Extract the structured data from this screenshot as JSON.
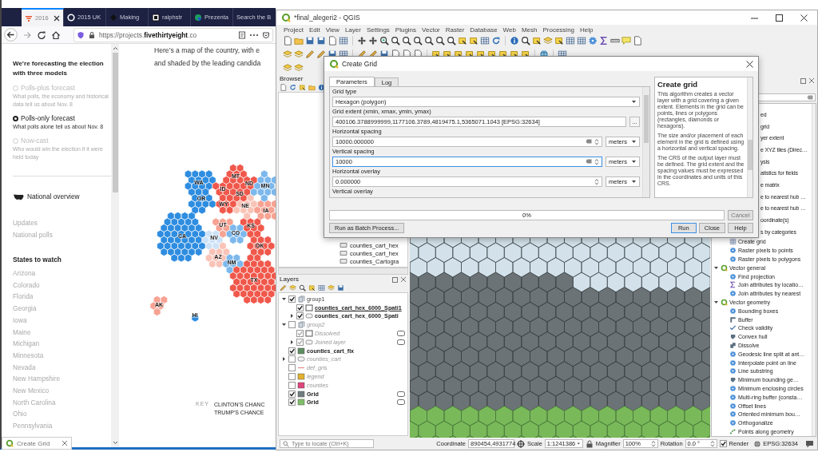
{
  "browser": {
    "tabs": [
      {
        "label": "2016",
        "selected": true
      },
      {
        "label": "2015 UK",
        "selected": false
      },
      {
        "label": "Making",
        "selected": false
      },
      {
        "label": "ralphstr",
        "selected": false
      },
      {
        "label": "Prezenta",
        "selected": false
      },
      {
        "label": "Search the B",
        "selected": false
      }
    ],
    "url": "https://projects.**fivethirtyeight**.co",
    "sidebar": {
      "heading": "We’re forecasting the election with three models",
      "models": [
        {
          "title": "Polls-plus forecast",
          "description": "What polls, the economy and historical data tell us about Nov. 8",
          "selected": false
        },
        {
          "title": "Polls-only forecast",
          "description": "What polls alone tell us about Nov. 8",
          "selected": true
        },
        {
          "title": "Now-cast",
          "description": "Who would win the election if it were held today",
          "selected": false
        }
      ],
      "nav": [
        {
          "label": "National overview",
          "kind": "overview"
        },
        {
          "label": "Updates",
          "kind": "link"
        },
        {
          "label": "National polls",
          "kind": "link"
        }
      ],
      "states_heading": "States to watch",
      "states": [
        "Arizona",
        "Colorado",
        "Florida",
        "Georgia",
        "Iowa",
        "Maine",
        "Michigan",
        "Minnesota",
        "Nevada",
        "New Hampshire",
        "New Mexico",
        "North Carolina",
        "Ohio",
        "Pennsylvania"
      ]
    },
    "article": {
      "text": "Here’s a map of the country, with e\nand shaded by the leading candida",
      "map_states": [
        {
          "label": "WA",
          "color": "#2e8de0"
        },
        {
          "label": "OR",
          "color": "#2e8de0"
        },
        {
          "label": "CA",
          "color": "#2e8de0"
        },
        {
          "label": "ID",
          "color": "#f0584b"
        },
        {
          "label": "MT",
          "color": "#f0584b"
        },
        {
          "label": "ND",
          "color": "#f0584b"
        },
        {
          "label": "SD",
          "color": "#f0584b"
        },
        {
          "label": "WY",
          "color": "#f0584b"
        },
        {
          "label": "NE",
          "color": "#fac3b7"
        },
        {
          "label": "IA",
          "color": "#f7a292"
        },
        {
          "label": "MN",
          "color": "#7cb8ec"
        },
        {
          "label": "UT",
          "color": "#f7a292"
        },
        {
          "label": "NV",
          "color": "#cde2f6"
        },
        {
          "label": "CO",
          "color": "#7cb8ec"
        },
        {
          "label": "KS",
          "color": "#f0584b"
        },
        {
          "label": "AZ",
          "color": "#fac3b7"
        },
        {
          "label": "NM",
          "color": "#7cb8ec"
        },
        {
          "label": "OK",
          "color": "#f0584b"
        },
        {
          "label": "TX",
          "color": "#f0584b"
        },
        {
          "label": "AK",
          "color": "#f7a292"
        },
        {
          "label": "HI",
          "color": "#2e8de0"
        }
      ],
      "key_label": "KEY",
      "key_items": [
        "CLINTON'S CHANC",
        "TRUMP'S CHANCE"
      ]
    },
    "taskbar_preview": {
      "title": "Create Grid"
    }
  },
  "qgis": {
    "title": "*final_alegeri2 - QGIS",
    "menu": [
      "Project",
      "Edit",
      "View",
      "Layer",
      "Settings",
      "Plugins",
      "Vector",
      "Raster",
      "Database",
      "Web",
      "Mesh",
      "Processing",
      "Help"
    ],
    "browser_panel": {
      "title": "Browser",
      "items": [
        "counties_cart_hex",
        "counties_cart_hex",
        "counties_Cartogra"
      ]
    },
    "layers_panel": {
      "title": "Layers",
      "layers": [
        {
          "name": "group1",
          "kind": "group",
          "checked": true,
          "expanded": true,
          "selected": false,
          "children": [
            {
              "name": "counties_cart_hex_6000_Spati1",
              "kind": "outline",
              "checked": true,
              "selected": true
            },
            {
              "name": "counties_cart_hex_6000_Spati",
              "kind": "categorized",
              "checked": true,
              "expanded": false,
              "selected": false
            }
          ]
        },
        {
          "name": "group2",
          "kind": "group",
          "checked": false,
          "expanded": true,
          "selected": false,
          "children": [
            {
              "name": "Dissolved",
              "kind": "outline",
              "checked": true,
              "indicator": true,
              "selected": false
            },
            {
              "name": "Joined layer",
              "kind": "categorized",
              "checked": true,
              "expanded": false,
              "indicator": true,
              "selected": false
            }
          ]
        },
        {
          "name": "counties_cart_fix",
          "kind": "fill",
          "color": "#5e8f62",
          "checked": true,
          "selected": false
        },
        {
          "name": "counties_cart",
          "kind": "categorized",
          "checked": false,
          "expanded": false,
          "selected": false
        },
        {
          "name": "def_gris",
          "kind": "line",
          "color": "#e58a8a",
          "checked": false,
          "selected": false
        },
        {
          "name": "legend",
          "kind": "fill",
          "color": "#e2b12f",
          "checked": false,
          "selected": false
        },
        {
          "name": "counties",
          "kind": "fill",
          "color": "#e0457b",
          "checked": false,
          "selected": false
        },
        {
          "name": "Grid",
          "kind": "fill",
          "color": "#6f7c80",
          "checked": true,
          "indicator": true,
          "selected": false
        },
        {
          "name": "Grid",
          "kind": "fill",
          "color": "#7fbf6a",
          "checked": true,
          "indicator": true,
          "selected": false
        }
      ]
    },
    "toolbox": {
      "items": [
        {
          "label": "ed",
          "kind": "covered"
        },
        {
          "label": "grid",
          "kind": "covered"
        },
        {
          "label": "yer extent",
          "kind": "covered"
        },
        {
          "label": "e XYZ tiles (Direc…",
          "kind": "covered"
        },
        {
          "label": "ysis",
          "kind": "covered"
        },
        {
          "label": "atistics for fields",
          "kind": "covered"
        },
        {
          "label": "e matrix",
          "kind": "covered"
        },
        {
          "label": "e to nearest hub …",
          "kind": "covered"
        },
        {
          "label": "e to nearest hub …",
          "kind": "covered"
        },
        {
          "label": "oordinate(s)",
          "kind": "covered"
        },
        {
          "label": "s by categories",
          "kind": "covered"
        },
        {
          "label": "Create grid",
          "kind": "grid"
        },
        {
          "label": "Raster pixels to points",
          "kind": "gear"
        },
        {
          "label": "Raster pixels to polygons",
          "kind": "gear"
        },
        {
          "label": "Vector general",
          "kind": "group",
          "expanded": true,
          "children": [
            {
              "label": "Find projection",
              "kind": "gear"
            },
            {
              "label": "Join attributes by locatio…",
              "kind": "sigma"
            },
            {
              "label": "Join attributes by nearest",
              "kind": "gear"
            }
          ]
        },
        {
          "label": "Vector geometry",
          "kind": "group",
          "expanded": true,
          "children": [
            {
              "label": "Bounding boxes",
              "kind": "gear"
            },
            {
              "label": "Buffer",
              "kind": "buffer"
            },
            {
              "label": "Check validity",
              "kind": "check"
            },
            {
              "label": "Convex hull",
              "kind": "hull"
            },
            {
              "label": "Dissolve",
              "kind": "dissolve"
            },
            {
              "label": "Geodesic line split at ant…",
              "kind": "gear"
            },
            {
              "label": "Interpolate point on line",
              "kind": "gear"
            },
            {
              "label": "Line substring",
              "kind": "gear"
            },
            {
              "label": "Minimum bounding ge…",
              "kind": "hull"
            },
            {
              "label": "Minimum enclosing circles",
              "kind": "gear"
            },
            {
              "label": "Multi-ring buffer (consta…",
              "kind": "gear"
            },
            {
              "label": "Offset lines",
              "kind": "gear"
            },
            {
              "label": "Oriented minimum bou…",
              "kind": "gear"
            },
            {
              "label": "Orthogonalize",
              "kind": "gear"
            },
            {
              "label": "Points along geometry",
              "kind": "points"
            }
          ]
        }
      ]
    },
    "status_bar": {
      "locate_placeholder": "Type to locate (Ctrl+K)",
      "coordinate_label": "Coordinate",
      "coordinate": "890454,4931774",
      "scale_label": "Scale",
      "scale": "1:1241386",
      "magnifier_label": "Magnifier",
      "magnifier": "100%",
      "rotation_label": "Rotation",
      "rotation": "0.0 °",
      "render_label": "Render",
      "render": true,
      "crs": "EPSG:32634"
    }
  },
  "dialog": {
    "title": "Create Grid",
    "tabs": [
      {
        "label": "Parameters",
        "selected": true
      },
      {
        "label": "Log",
        "selected": false
      }
    ],
    "params": [
      {
        "kind": "select",
        "label": "Grid type",
        "value": "Hexagon (polygon)"
      },
      {
        "kind": "extent",
        "label": "Grid extent (xmin, xmax, ymin, ymax)",
        "value": "400106.3788999999,1177106.3789,4819475.1,5365071.1043 [EPSG:32634]",
        "button": "..."
      },
      {
        "kind": "distance",
        "label": "Horizontal spacing",
        "value": "10000.000000",
        "unit": "meters",
        "focused": false
      },
      {
        "kind": "distance",
        "label": "Vertical spacing",
        "value": "10000",
        "unit": "meters",
        "focused": true
      },
      {
        "kind": "number",
        "label": "Horizontal overlay",
        "value": "0.000000",
        "unit": "meters",
        "focused": false
      },
      {
        "kind": "heading",
        "label": "Vertical overlay"
      }
    ],
    "help": {
      "title": "Create grid",
      "paragraphs": [
        "This algorithm creates a vector layer with a grid covering a given extent. Elements in the grid can be points, lines or polygons (rectangles, diamonds or hexagons).",
        "The size and/or placement of each element in the grid is defined using a horizontal and vertical spacing.",
        "The CRS of the output layer must be defined. The grid extent and the spacing values must be expressed in the coordinates and units of this CRS."
      ]
    },
    "progress": {
      "level": 0,
      "text": "0%"
    },
    "cancel": {
      "label": "Cancel",
      "disabled": true
    },
    "batch": "Run as Batch Process...",
    "buttons": [
      {
        "label": "Run",
        "default": true
      },
      {
        "label": "Close",
        "default": false
      },
      {
        "label": "Help",
        "default": false
      }
    ]
  }
}
